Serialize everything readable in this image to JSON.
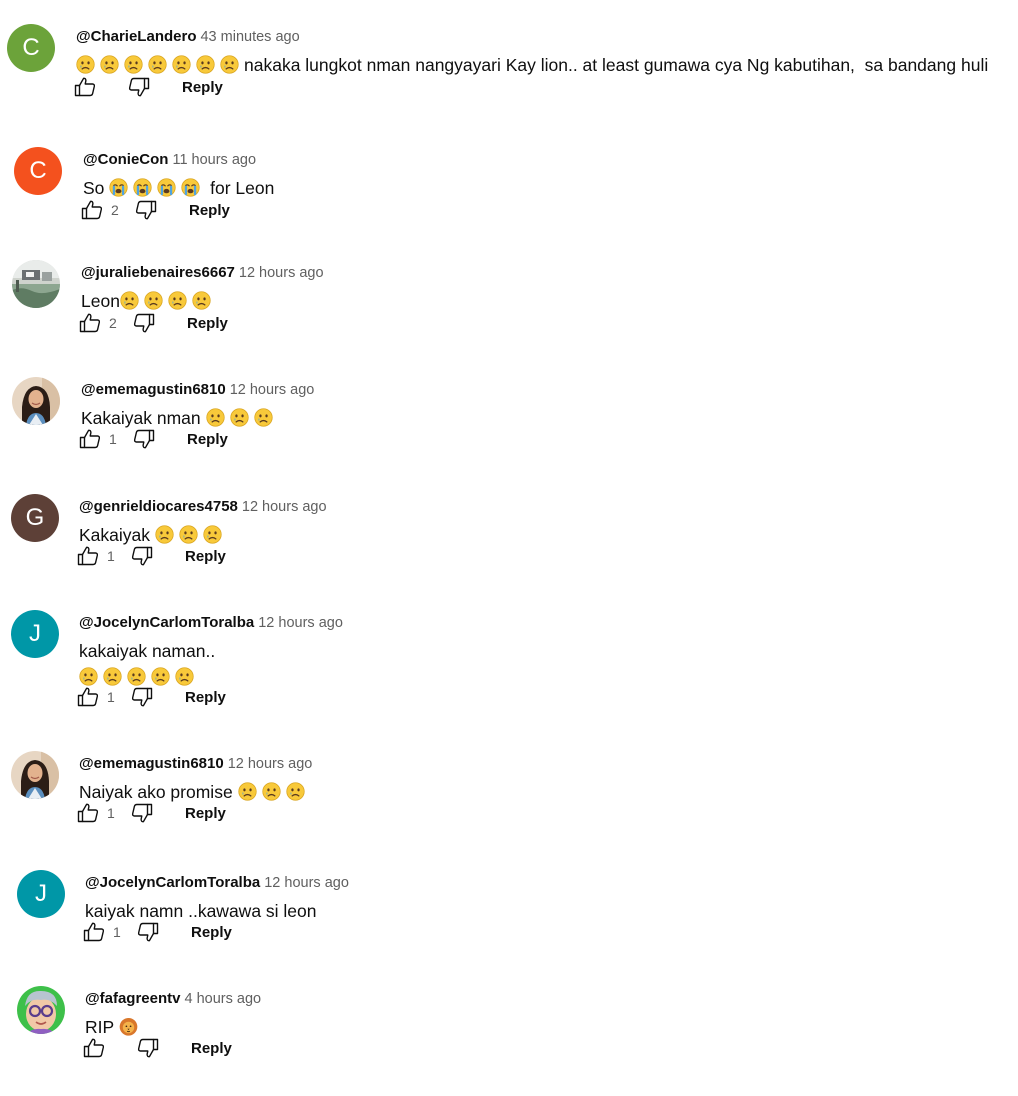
{
  "reply_label": "Reply",
  "comments": [
    {
      "avatar": {
        "type": "letter",
        "letter": "C",
        "color": "#6ca33a"
      },
      "author": "@CharieLandero",
      "time": "43 minutes ago",
      "segments": [
        {
          "e": "sad"
        },
        {
          "e": "sad"
        },
        {
          "e": "sad"
        },
        {
          "e": "sad"
        },
        {
          "e": "sad"
        },
        {
          "e": "sad"
        },
        {
          "e": "sad"
        },
        {
          "t": "nakaka lungkot nman nangyayari Kay lion.. at least gumawa cya Ng kabutihan,  sa bandang huli"
        }
      ],
      "likes": ""
    },
    {
      "avatar": {
        "type": "letter",
        "letter": "C",
        "color": "#f4511e"
      },
      "author": "@ConieCon",
      "time": "11 hours ago",
      "segments": [
        {
          "t": "So "
        },
        {
          "e": "cry"
        },
        {
          "e": "cry"
        },
        {
          "e": "cry"
        },
        {
          "e": "cry"
        },
        {
          "t": " for Leon"
        }
      ],
      "likes": "2"
    },
    {
      "avatar": {
        "type": "photo",
        "kind": "landscape"
      },
      "author": "@juraliebenaires6667",
      "time": "12 hours ago",
      "segments": [
        {
          "t": "Leon"
        },
        {
          "e": "sad"
        },
        {
          "e": "sad"
        },
        {
          "e": "sad"
        },
        {
          "e": "sad"
        }
      ],
      "likes": "2"
    },
    {
      "avatar": {
        "type": "photo",
        "kind": "woman"
      },
      "author": "@ememagustin6810",
      "time": "12 hours ago",
      "segments": [
        {
          "t": "Kakaiyak nman "
        },
        {
          "e": "sad"
        },
        {
          "e": "sad"
        },
        {
          "e": "sad"
        }
      ],
      "likes": "1"
    },
    {
      "avatar": {
        "type": "letter",
        "letter": "G",
        "color": "#5d4037"
      },
      "author": "@genrieldiocares4758",
      "time": "12 hours ago",
      "segments": [
        {
          "t": "Kakaiyak "
        },
        {
          "e": "sad"
        },
        {
          "e": "sad"
        },
        {
          "e": "sad"
        }
      ],
      "likes": "1"
    },
    {
      "avatar": {
        "type": "letter",
        "letter": "J",
        "color": "#0097a7"
      },
      "author": "@JocelynCarlomToralba",
      "time": "12 hours ago",
      "segments": [
        {
          "t": "kakaiyak naman.."
        },
        {
          "br": true
        },
        {
          "e": "sad"
        },
        {
          "e": "sad"
        },
        {
          "e": "sad"
        },
        {
          "e": "sad"
        },
        {
          "e": "sad"
        }
      ],
      "likes": "1"
    },
    {
      "avatar": {
        "type": "photo",
        "kind": "woman"
      },
      "author": "@ememagustin6810",
      "time": "12 hours ago",
      "segments": [
        {
          "t": "Naiyak ako promise "
        },
        {
          "e": "sad"
        },
        {
          "e": "sad"
        },
        {
          "e": "sad"
        }
      ],
      "likes": "1"
    },
    {
      "avatar": {
        "type": "letter",
        "letter": "J",
        "color": "#0097a7"
      },
      "author": "@JocelynCarlomToralba",
      "time": "12 hours ago",
      "segments": [
        {
          "t": "kaiyak namn ..kawawa si leon"
        }
      ],
      "likes": "1"
    },
    {
      "avatar": {
        "type": "photo",
        "kind": "cartoon"
      },
      "author": "@fafagreentv",
      "time": "4 hours ago",
      "segments": [
        {
          "t": "RIP "
        },
        {
          "e": "lion"
        }
      ],
      "likes": ""
    }
  ]
}
